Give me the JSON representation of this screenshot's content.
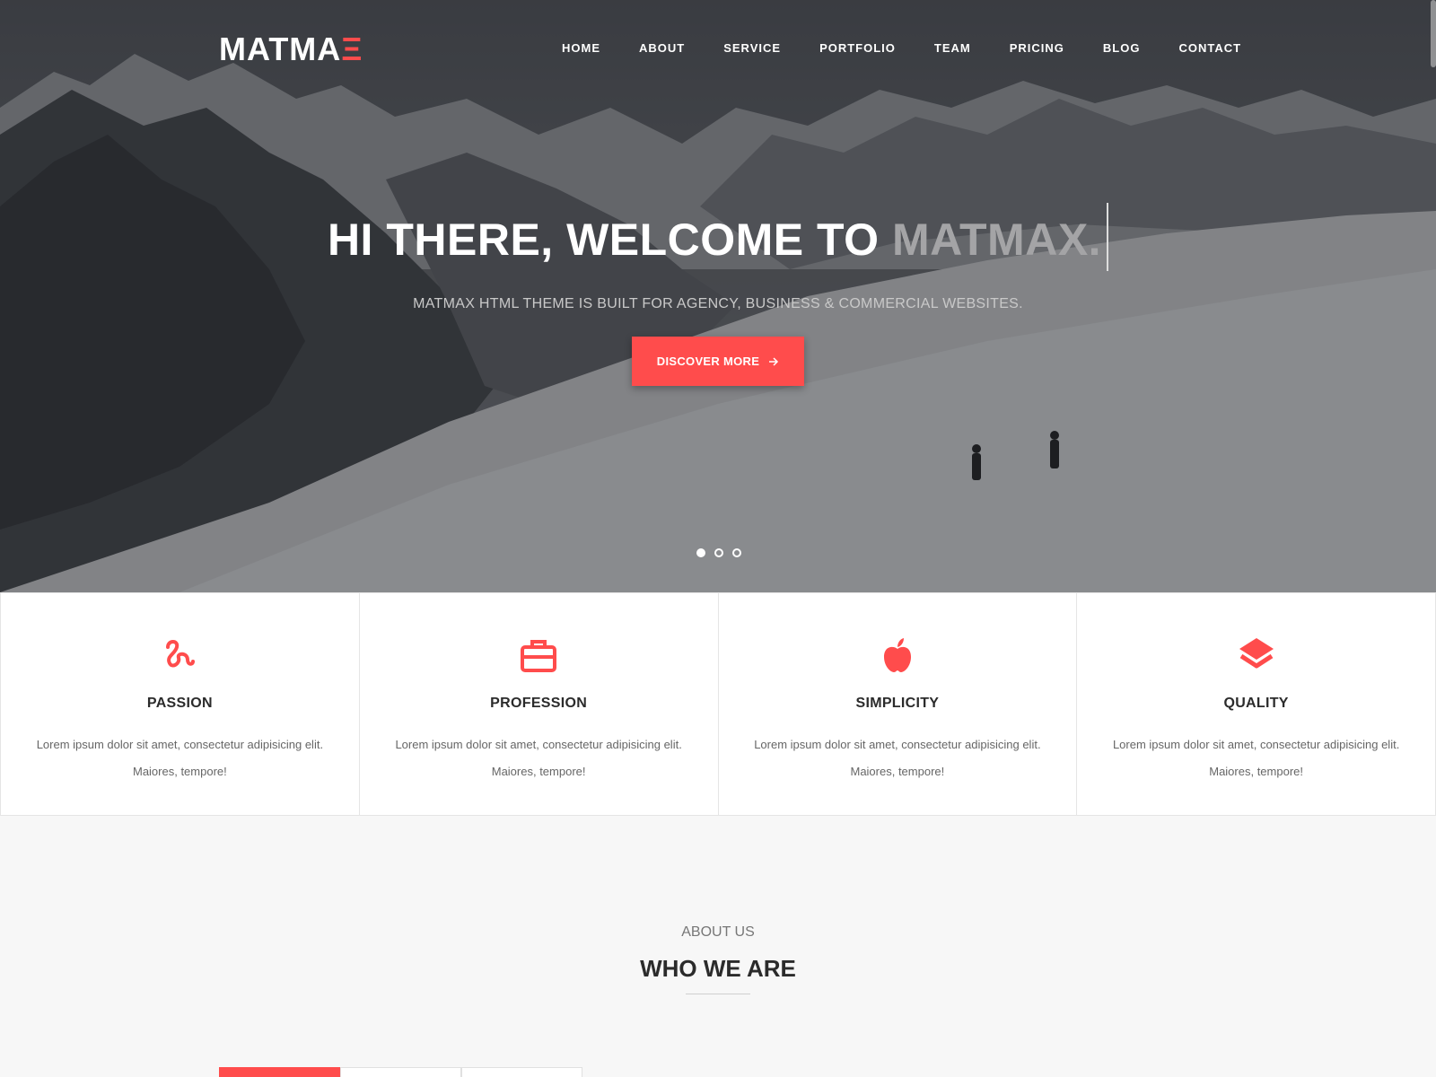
{
  "brand": {
    "logo_main": "MATMA",
    "logo_accent": "Ξ",
    "accent_color": "#ff4c4c"
  },
  "nav": {
    "items": [
      {
        "label": "HOME"
      },
      {
        "label": "ABOUT"
      },
      {
        "label": "SERVICE"
      },
      {
        "label": "PORTFOLIO"
      },
      {
        "label": "TEAM"
      },
      {
        "label": "PRICING"
      },
      {
        "label": "BLOG"
      },
      {
        "label": "CONTACT"
      }
    ]
  },
  "hero": {
    "title_prefix": "HI THERE, WELCOME TO ",
    "title_highlight": "MATMAX.",
    "subtitle": "MATMAX HTML THEME IS BUILT FOR AGENCY, BUSINESS & COMMERCIAL WEBSITES.",
    "button_label": "DISCOVER MORE",
    "button_icon": "arrow-right-icon",
    "slides": 3,
    "active_slide": 1
  },
  "features": [
    {
      "icon": "squiggle-icon",
      "title": "PASSION",
      "text": "Lorem ipsum dolor sit amet, consectetur adipisicing elit. Maiores, tempore!"
    },
    {
      "icon": "briefcase-icon",
      "title": "PROFESSION",
      "text": "Lorem ipsum dolor sit amet, consectetur adipisicing elit. Maiores, tempore!"
    },
    {
      "icon": "apple-icon",
      "title": "SIMPLICITY",
      "text": "Lorem ipsum dolor sit amet, consectetur adipisicing elit. Maiores, tempore!"
    },
    {
      "icon": "layers-icon",
      "title": "QUALITY",
      "text": "Lorem ipsum dolor sit amet, consectetur adipisicing elit. Maiores, tempore!"
    }
  ],
  "about": {
    "label": "ABOUT US",
    "title": "WHO WE ARE"
  }
}
